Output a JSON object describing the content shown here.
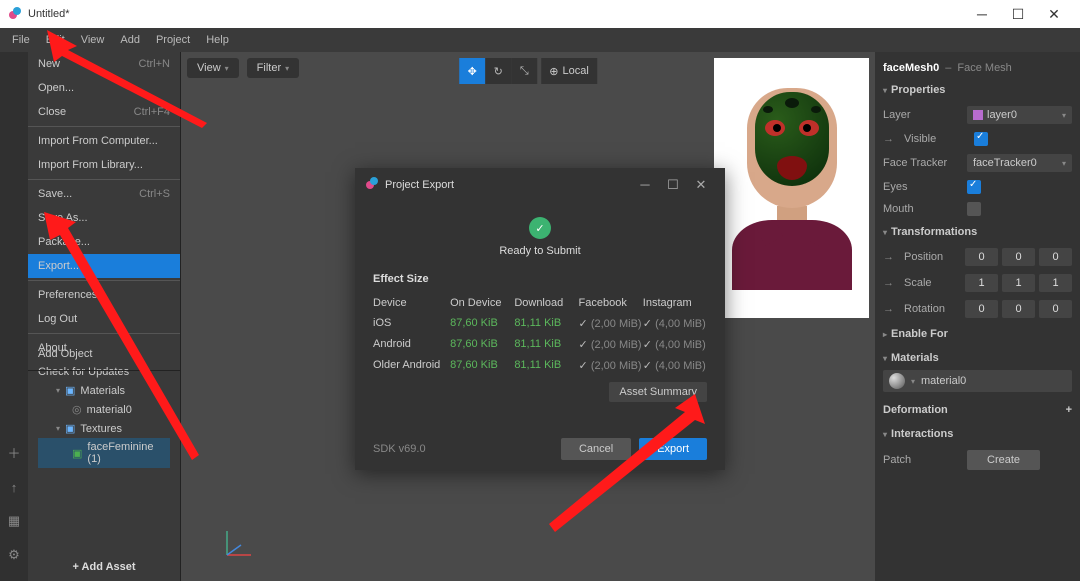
{
  "window": {
    "title": "Untitled*"
  },
  "menubar": [
    "File",
    "Edit",
    "View",
    "Add",
    "Project",
    "Help"
  ],
  "filemenu": {
    "new": {
      "label": "New",
      "shortcut": "Ctrl+N"
    },
    "open": {
      "label": "Open..."
    },
    "close": {
      "label": "Close",
      "shortcut": "Ctrl+F4"
    },
    "importComputer": {
      "label": "Import From Computer..."
    },
    "importLibrary": {
      "label": "Import From Library..."
    },
    "save": {
      "label": "Save...",
      "shortcut": "Ctrl+S"
    },
    "saveAs": {
      "label": "Save As..."
    },
    "package": {
      "label": "Package..."
    },
    "export": {
      "label": "Export..."
    },
    "preferences": {
      "label": "Preferences"
    },
    "logOut": {
      "label": "Log Out"
    },
    "about": {
      "label": "About"
    },
    "checkUpdates": {
      "label": "Check for Updates"
    }
  },
  "addObject": "Add Object",
  "tree": {
    "materials": "Materials",
    "material0": "material0",
    "textures": "Textures",
    "faceFeminine": "faceFeminine (1)"
  },
  "addAsset": "+  Add Asset",
  "viewport": {
    "view": "View",
    "filter": "Filter",
    "local": "Local"
  },
  "modal": {
    "title": "Project Export",
    "ready": "Ready to Submit",
    "effectSize": "Effect Size",
    "headers": {
      "device": "Device",
      "onDevice": "On Device",
      "download": "Download",
      "facebook": "Facebook",
      "instagram": "Instagram"
    },
    "rows": [
      {
        "device": "iOS",
        "onDevice": "87,60 KiB",
        "download": "81,11 KiB",
        "fb": "(2,00 MiB)",
        "ig": "(4,00 MiB)"
      },
      {
        "device": "Android",
        "onDevice": "87,60 KiB",
        "download": "81,11 KiB",
        "fb": "(2,00 MiB)",
        "ig": "(4,00 MiB)"
      },
      {
        "device": "Older Android",
        "onDevice": "87,60 KiB",
        "download": "81,11 KiB",
        "fb": "(2,00 MiB)",
        "ig": "(4,00 MiB)"
      }
    ],
    "assetSummary": "Asset Summary",
    "sdk": "SDK v69.0",
    "cancel": "Cancel",
    "export": "Export"
  },
  "inspector": {
    "name": "faceMesh0",
    "type": "Face Mesh",
    "properties": "Properties",
    "layer": {
      "label": "Layer",
      "value": "layer0"
    },
    "visible": {
      "label": "Visible"
    },
    "faceTracker": {
      "label": "Face Tracker",
      "value": "faceTracker0"
    },
    "eyes": {
      "label": "Eyes"
    },
    "mouth": {
      "label": "Mouth"
    },
    "transformations": "Transformations",
    "position": {
      "label": "Position",
      "x": "0",
      "y": "0",
      "z": "0"
    },
    "scale": {
      "label": "Scale",
      "x": "1",
      "y": "1",
      "z": "1"
    },
    "rotation": {
      "label": "Rotation",
      "x": "0",
      "y": "0",
      "z": "0"
    },
    "enableFor": "Enable For",
    "materials": "Materials",
    "material0": "material0",
    "deformation": "Deformation",
    "interactions": "Interactions",
    "patch": "Patch",
    "create": "Create"
  }
}
